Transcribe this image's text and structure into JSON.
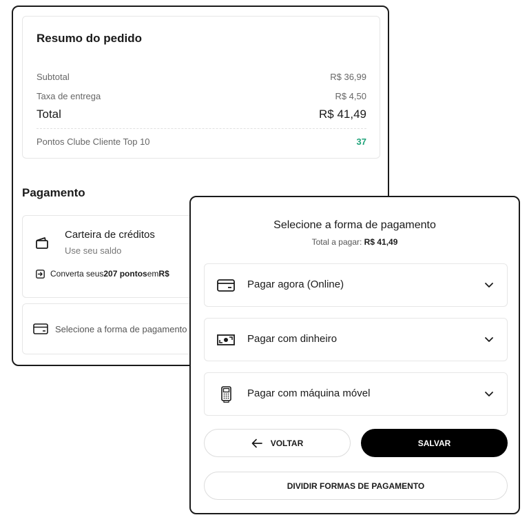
{
  "summary": {
    "title": "Resumo do pedido",
    "subtotal_label": "Subtotal",
    "subtotal_value": "R$ 36,99",
    "delivery_label": "Taxa de entrega",
    "delivery_value": "R$ 4,50",
    "total_label": "Total",
    "total_value": "R$ 41,49",
    "points_label": "Pontos Clube Cliente Top 10",
    "points_value": "37"
  },
  "payment": {
    "heading": "Pagamento",
    "wallet_title": "Carteira de créditos",
    "wallet_subtitle": "Use seu saldo",
    "convert_prefix": "Converta seus ",
    "convert_points": "207 pontos",
    "convert_middle": " em ",
    "convert_amount": "R$",
    "select_label": "Selecione a forma de pagamento"
  },
  "modal": {
    "title": "Selecione a forma de pagamento",
    "total_prefix": "Total a pagar: ",
    "total_value": "R$ 41,49",
    "options": [
      {
        "label": "Pagar agora (Online)",
        "icon": "credit-card-icon"
      },
      {
        "label": "Pagar com dinheiro",
        "icon": "cash-icon"
      },
      {
        "label": "Pagar com máquina móvel",
        "icon": "card-machine-icon"
      }
    ],
    "back_label": "VOLTAR",
    "save_label": "SALVAR",
    "split_label": "DIVIDIR FORMAS DE PAGAMENTO"
  },
  "colors": {
    "points_accent": "#1fa37a",
    "primary_button": "#000000"
  }
}
